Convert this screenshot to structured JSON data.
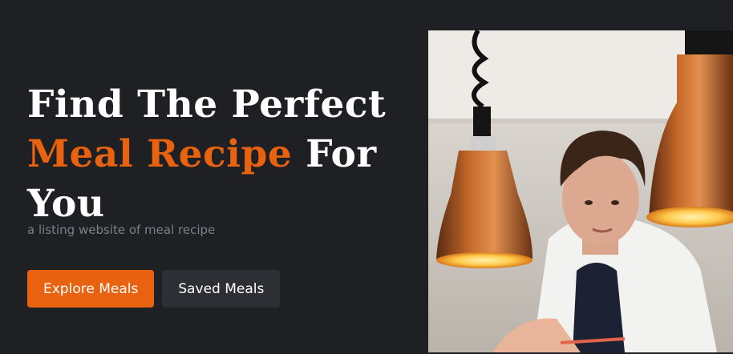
{
  "hero": {
    "title_line1": "Find The Perfect",
    "title_accent": "Meal Recipe",
    "title_tail": " For",
    "title_line3": "You",
    "subtitle": "a listing website of meal recipe"
  },
  "actions": {
    "explore_label": "Explore Meals",
    "saved_label": "Saved Meals"
  },
  "colors": {
    "background": "#1f2024",
    "accent": "#e8620f",
    "secondary_button": "#2d2f35"
  },
  "image": {
    "description_icon": "chef-photo"
  }
}
